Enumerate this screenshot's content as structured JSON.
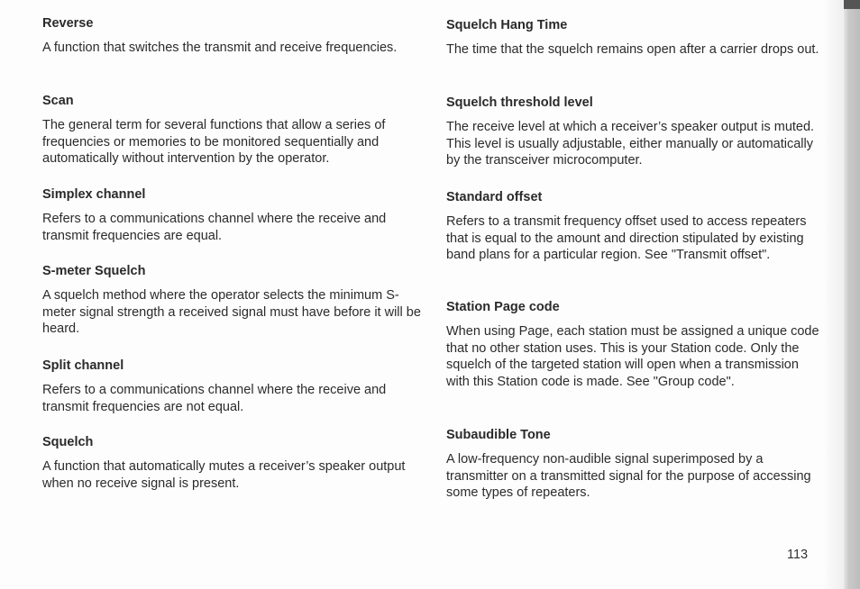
{
  "document": {
    "type": "glossary",
    "page_number": "113",
    "left_column": [
      {
        "term": "Reverse",
        "definition": "A function that switches the transmit and receive frequencies."
      },
      {
        "term": "Scan",
        "definition": "The general term for several functions that allow a series of frequencies or memories to be monitored sequentially and automatically without intervention by the operator."
      },
      {
        "term": "Simplex channel",
        "definition": "Refers to a communications channel where the receive and transmit frequencies are equal."
      },
      {
        "term": "S-meter Squelch",
        "definition": "A squelch method where the operator selects the minimum S-meter signal strength a received signal must have before it will be heard."
      },
      {
        "term": "Split channel",
        "definition": "Refers to a communications channel where the receive and transmit frequencies are not equal."
      },
      {
        "term": "Squelch",
        "definition": "A function that automatically mutes a receiver’s speaker output when no receive signal is present."
      }
    ],
    "right_column": [
      {
        "term": "Squelch Hang Time",
        "definition": "The time that the squelch remains open after a carrier drops out."
      },
      {
        "term": "Squelch threshold level",
        "definition": "The receive level at which a receiver’s speaker output is muted.  This level is usually adjustable, either manually or automatically by the transceiver microcomputer."
      },
      {
        "term": "Standard offset",
        "definition": "Refers to a transmit frequency offset used to access repeaters that is equal to the amount and direction stipulated by existing band plans for a particular region. See \"Transmit offset\"."
      },
      {
        "term": "Station Page code",
        "definition": "When using Page, each station must be assigned a unique code that no other station uses.  This is your Station code.  Only the squelch of the targeted station will open when a transmission with this Station code is made.  See \"Group code\"."
      },
      {
        "term": "Subaudible Tone",
        "definition": "A low-frequency non-audible signal superimposed by a transmitter on a transmitted signal for the purpose of accessing some types of repeaters."
      }
    ]
  }
}
